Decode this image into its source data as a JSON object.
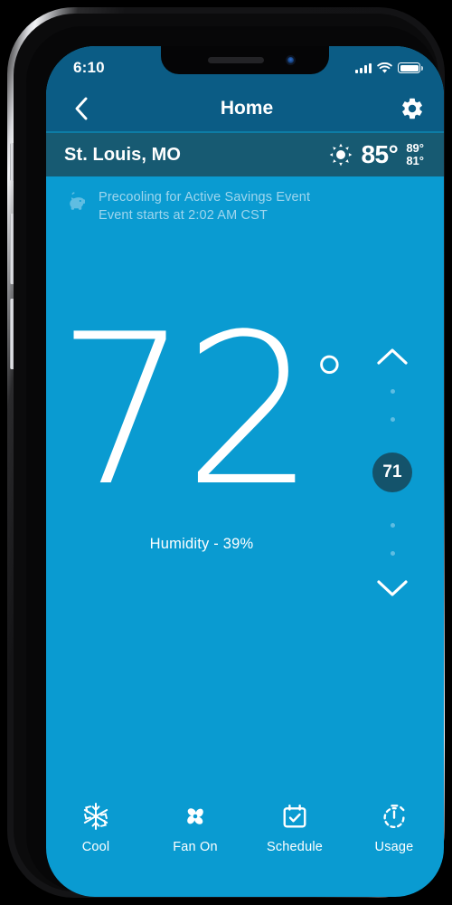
{
  "device": {
    "status_bar": {
      "time": "6:10",
      "signal_icon": "cellular-signal-icon",
      "wifi_icon": "wifi-icon",
      "battery_icon": "battery-full-icon"
    }
  },
  "nav": {
    "back_icon": "chevron-left-icon",
    "title": "Home",
    "settings_icon": "gear-icon"
  },
  "weather": {
    "location": "St. Louis, MO",
    "condition_icon": "sun-icon",
    "current_temp": "85°",
    "high": "89°",
    "low": "81°"
  },
  "event_banner": {
    "icon": "piggy-bank-icon",
    "line1": "Precooling for Active Savings Event",
    "line2": "Event starts at 2:02 AM CST"
  },
  "thermostat": {
    "current_temp": "72",
    "degree_symbol": "°",
    "humidity_label": "Humidity - 39%",
    "stepper": {
      "up_icon": "chevron-up-icon",
      "down_icon": "chevron-down-icon",
      "setpoint": "71",
      "tick_count_top": 2,
      "tick_count_bottom": 2
    }
  },
  "tabs": [
    {
      "icon": "snowflake-icon",
      "label": "Cool"
    },
    {
      "icon": "fan-icon",
      "label": "Fan On"
    },
    {
      "icon": "calendar-check-icon",
      "label": "Schedule"
    },
    {
      "icon": "stopwatch-icon",
      "label": "Usage"
    }
  ],
  "colors": {
    "screen_background": "#0a9bd1",
    "header_background": "#0b5c85",
    "weather_bar_background": "#175a72",
    "setpoint_circle": "#14536b",
    "banner_text": "#9fd6ee",
    "tick": "#5ebde2",
    "text_primary": "#ffffff"
  }
}
